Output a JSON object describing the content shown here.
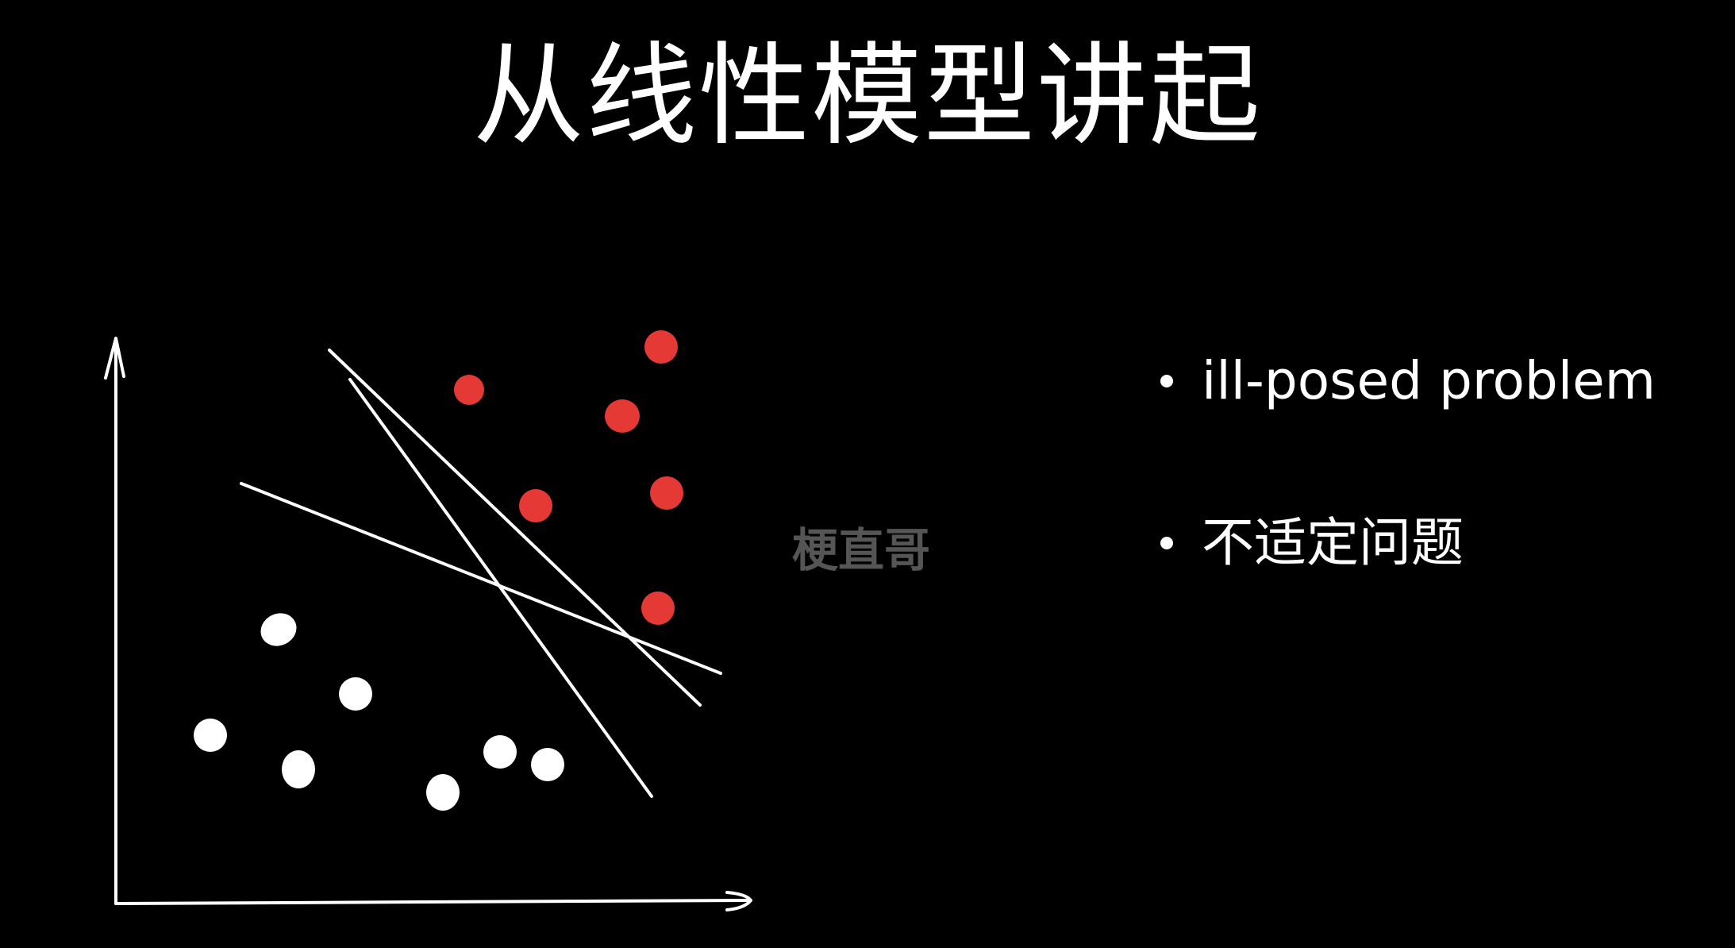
{
  "slide": {
    "title": "从线性模型讲起",
    "watermark": "梗直哥",
    "bullets": [
      "ill-posed problem",
      "不适定问题"
    ]
  },
  "colors": {
    "background": "#000000",
    "class_a": "#e53935",
    "class_b": "#ffffff",
    "line": "#ffffff",
    "watermark": "#555555"
  },
  "icons": {
    "bullet": "bullet-dot"
  }
}
